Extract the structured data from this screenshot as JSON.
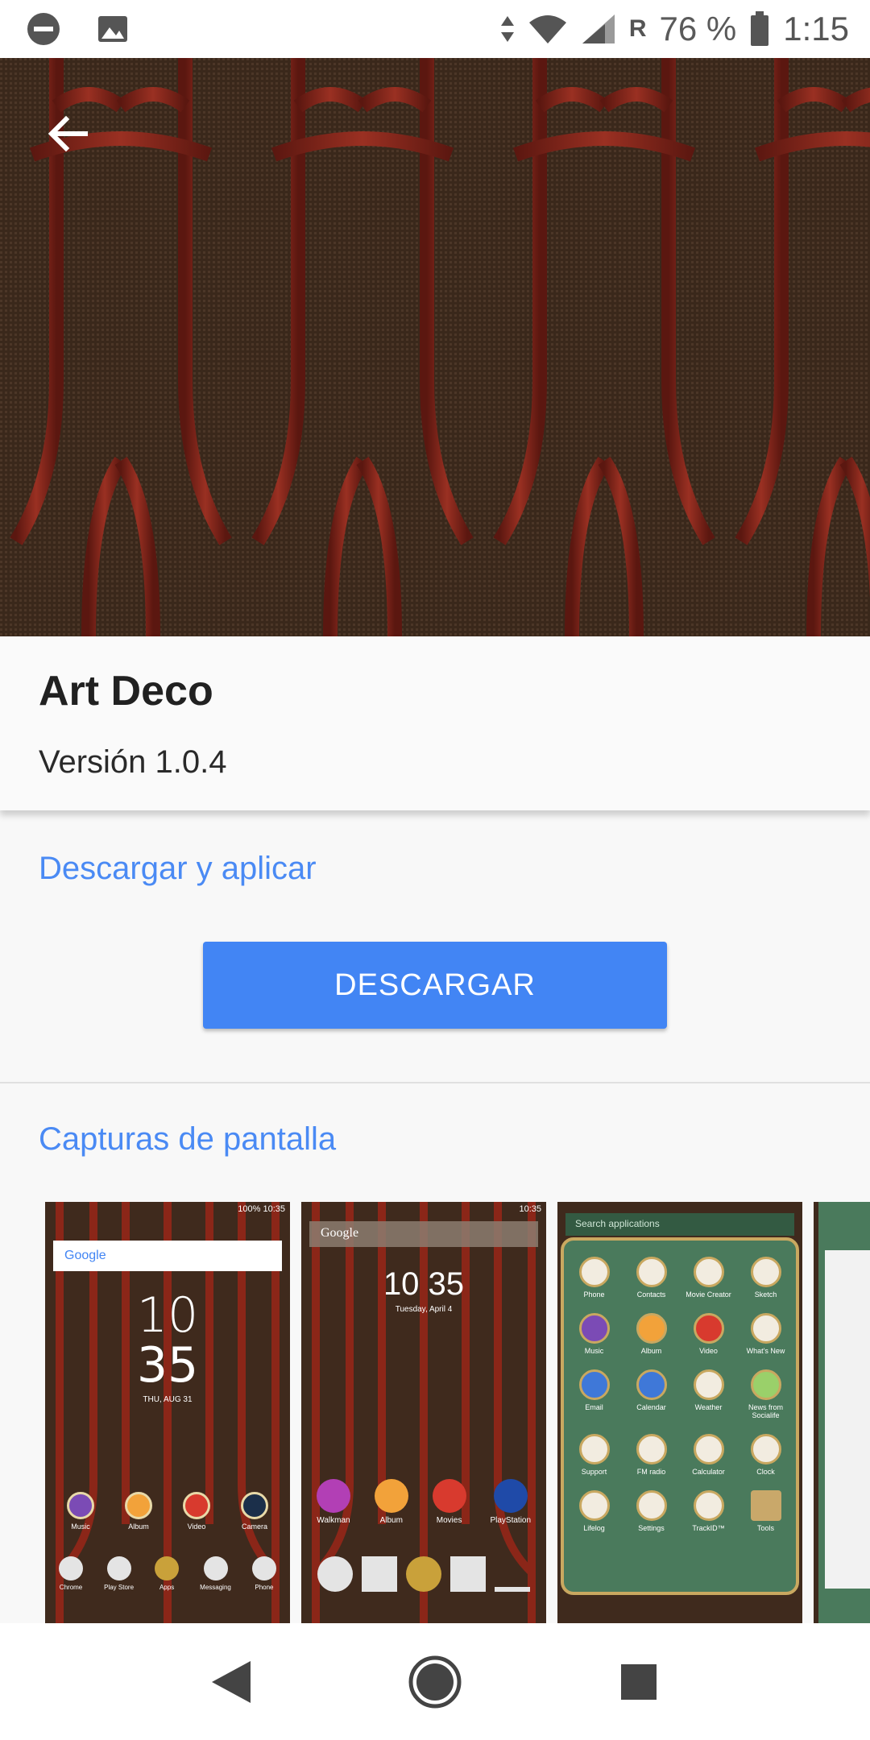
{
  "status_bar": {
    "roaming": "R",
    "battery": "76 %",
    "time": "1:15"
  },
  "theme": {
    "title": "Art Deco",
    "version": "Versión 1.0.4"
  },
  "download_section": {
    "heading": "Descargar y aplicar",
    "button_label": "DESCARGAR"
  },
  "screenshots_section": {
    "heading": "Capturas de pantalla",
    "shots": [
      {
        "name": "home-screen-1",
        "status": "100% 10:35",
        "clock_h": "10",
        "clock_m": "35",
        "date": "THU, AUG 31",
        "search": "Google",
        "apps": [
          "Music",
          "Album",
          "Video",
          "Camera"
        ],
        "dock": [
          "Chrome",
          "Play Store",
          "Apps",
          "Messaging",
          "Phone"
        ]
      },
      {
        "name": "home-screen-2",
        "status": "10:35",
        "clock": "10 35",
        "date": "Tuesday, April 4",
        "search": "Google",
        "apps": [
          "Walkman",
          "Album",
          "Movies",
          "PlayStation"
        ]
      },
      {
        "name": "app-drawer",
        "search": "Search applications",
        "apps": [
          "Phone",
          "Contacts",
          "Movie Creator",
          "Sketch",
          "Music",
          "Album",
          "Video",
          "What's New",
          "Email",
          "Calendar",
          "Weather",
          "News from Socialife",
          "Support",
          "FM radio",
          "Calculator",
          "Clock",
          "Lifelog",
          "Settings",
          "TrackID™",
          "Tools"
        ]
      }
    ]
  },
  "colors": {
    "accent": "#4285f4",
    "heading_blue": "#4a8af4",
    "wood": "#7a1f14",
    "panel": "#3d2a1c"
  }
}
